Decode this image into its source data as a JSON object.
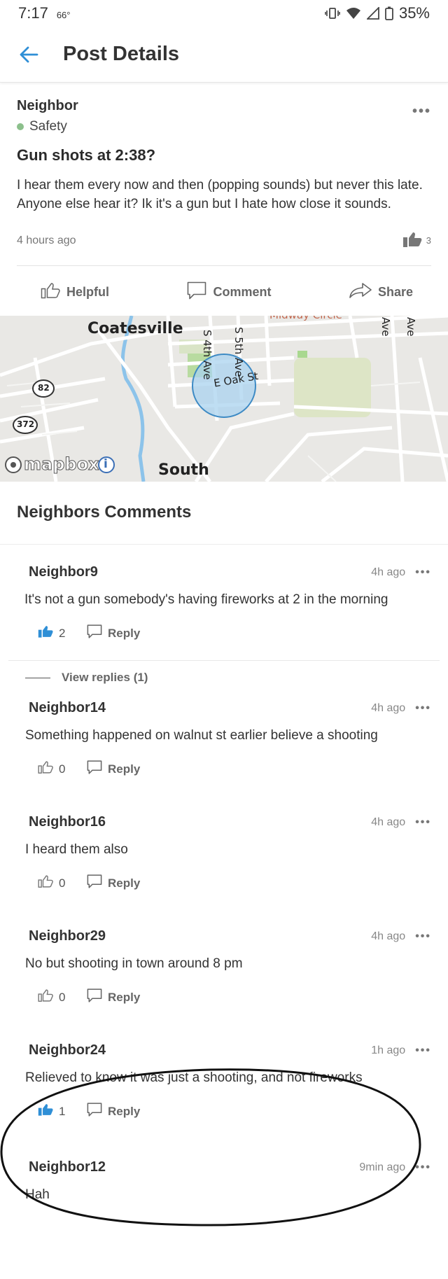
{
  "status_bar": {
    "time": "7:17",
    "temp": "66°",
    "battery": "35%"
  },
  "header": {
    "title": "Post Details"
  },
  "post": {
    "author": "Neighbor",
    "category": "Safety",
    "title": "Gun shots at 2:38?",
    "body": "I hear them every now and then (popping sounds) but never this late. Anyone else hear it? Ik it's a gun but I hate how close it sounds.",
    "time": "4 hours ago",
    "likes": "3",
    "actions": {
      "helpful": "Helpful",
      "comment": "Comment",
      "share": "Share"
    }
  },
  "map": {
    "labels": {
      "town": "Coatesville",
      "south": "South",
      "street_4th": "S 4th Ave",
      "street_5th": "S 5th Ave",
      "street_oak": "E Oak St",
      "top_street": "Midway Circle",
      "ave_1": "Ave",
      "ave_2": "Ave",
      "route_82": "82",
      "route_372": "372",
      "brand": "mapbox",
      "info": "i"
    }
  },
  "comments_section": {
    "title": "Neighbors Comments",
    "view_replies": "View replies (1)",
    "reply_label": "Reply",
    "comments": [
      {
        "name": "Neighbor9",
        "time": "4h ago",
        "text": "It's not a gun somebody's having fireworks at 2 in the morning",
        "likes": "2",
        "liked": true
      },
      {
        "name": "Neighbor14",
        "time": "4h ago",
        "text": "Something happened on walnut st earlier believe a shooting",
        "likes": "0",
        "liked": false
      },
      {
        "name": "Neighbor16",
        "time": "4h ago",
        "text": "I heard them also",
        "likes": "0",
        "liked": false
      },
      {
        "name": "Neighbor29",
        "time": "4h ago",
        "text": "No but shooting in town around 8 pm",
        "likes": "0",
        "liked": false
      },
      {
        "name": "Neighbor24",
        "time": "1h ago",
        "text": "Relieved to know it was just a shooting, and not fireworks",
        "likes": "1",
        "liked": true
      },
      {
        "name": "Neighbor12",
        "time": "9min ago",
        "text": "Hah",
        "likes": "",
        "liked": false
      }
    ]
  },
  "colors": {
    "accent_blue": "#2f8fd6",
    "map_circle_fill": "#a9d3ef",
    "map_circle_stroke": "#3d8ac4",
    "safety_dot": "#8cc08c"
  }
}
